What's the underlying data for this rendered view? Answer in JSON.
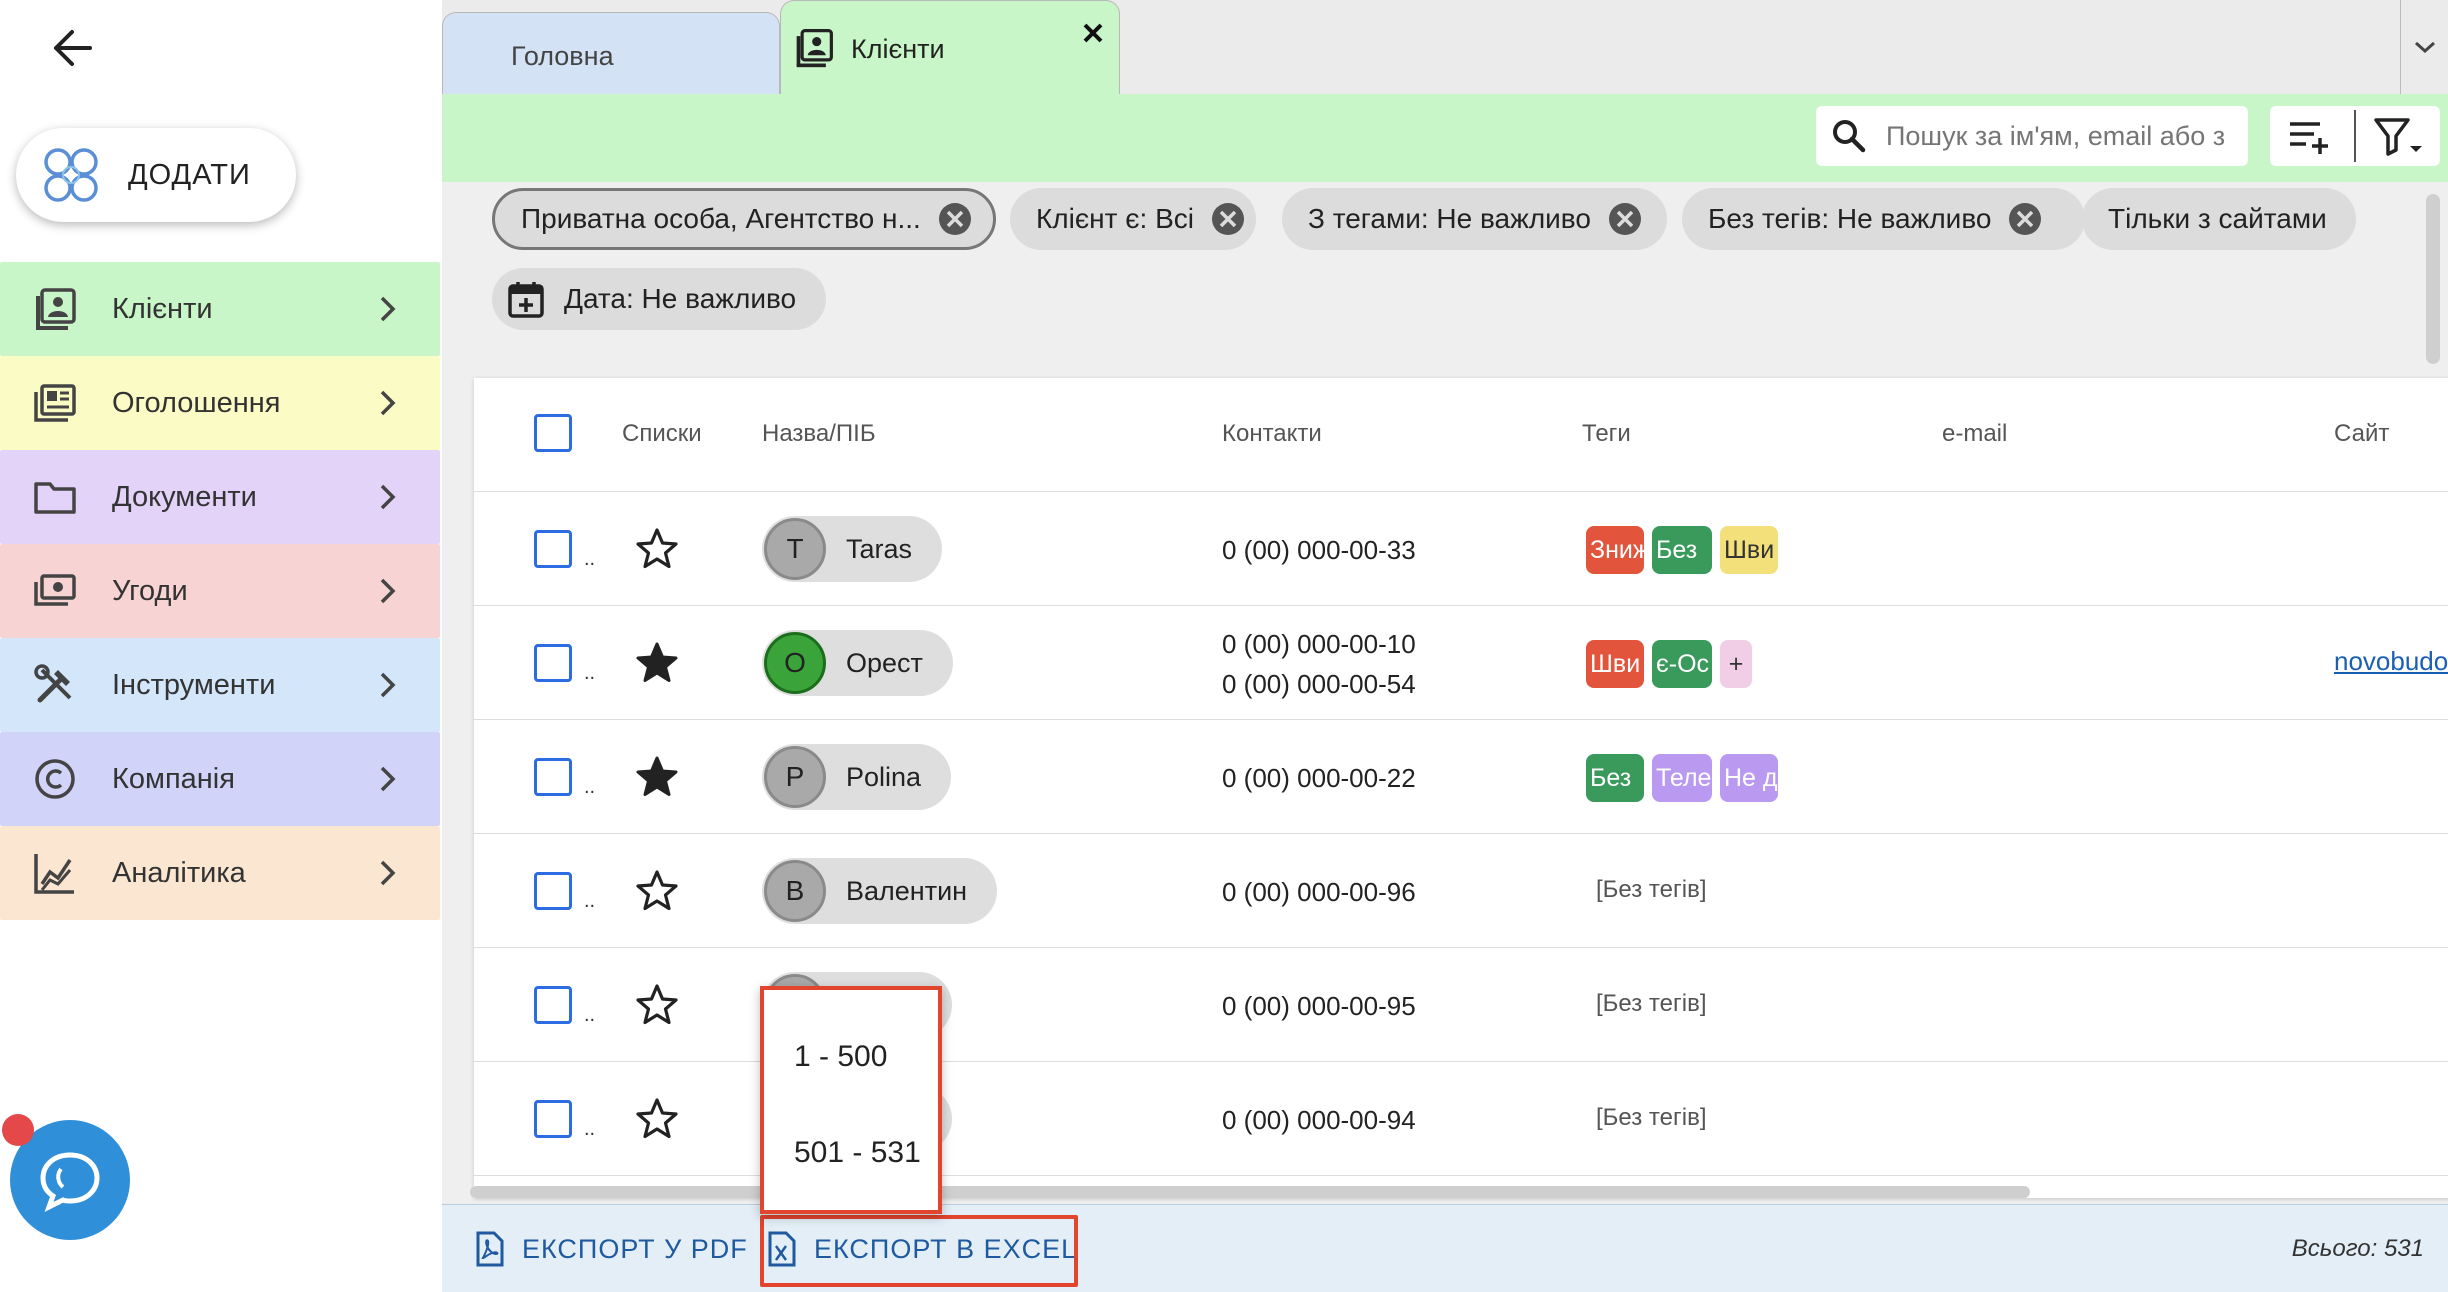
{
  "sidebar": {
    "add_label": "ДОДАТИ",
    "items": [
      {
        "label": "Клієнти",
        "color": "#c9f6c8"
      },
      {
        "label": "Оголошення",
        "color": "#fbfbc6"
      },
      {
        "label": "Документи",
        "color": "#e4d3f8"
      },
      {
        "label": "Угоди",
        "color": "#f7d4d3"
      },
      {
        "label": "Інструменти",
        "color": "#d3e6fa"
      },
      {
        "label": "Компанія",
        "color": "#d2d3f8"
      },
      {
        "label": "Аналітика",
        "color": "#fbe6d2"
      }
    ]
  },
  "tabs": {
    "home": "Головна",
    "clients": "Клієнти"
  },
  "search": {
    "placeholder": "Пошук за ім'ям, email або з"
  },
  "filters": {
    "chip1": "Приватна особа, Агентство н...",
    "chip2": "Клієнт є: Всі",
    "chip3": "З тегами: Не важливо",
    "chip4": "Без тегів: Не важливо",
    "chip5": "Тільки з сайтами",
    "chip6": "Дата: Не важливо"
  },
  "table": {
    "headers": {
      "lists": "Списки",
      "name": "Назва/ПІБ",
      "contacts": "Контакти",
      "tags": "Теги",
      "email": "e-mail",
      "site": "Сайт"
    },
    "rows": [
      {
        "dots": "..",
        "starred": false,
        "initial": "T",
        "name": "Taras",
        "contacts": [
          "0 (00) 000-00-33"
        ],
        "tags": [
          {
            "text": "Зниж",
            "color": "#e2553c"
          },
          {
            "text": "Без",
            "color": "#3a9a5c"
          },
          {
            "text": "Шви",
            "color": "#f3e07a"
          }
        ],
        "site": ""
      },
      {
        "dots": "..",
        "starred": true,
        "initial": "O",
        "name": "Орест",
        "contacts": [
          "0 (00) 000-00-10",
          "0 (00) 000-00-54"
        ],
        "tags": [
          {
            "text": "Шви",
            "color": "#e2553c"
          },
          {
            "text": "є-Ос",
            "color": "#3a9a5c"
          },
          {
            "text": "+",
            "color": "#f1cde6"
          }
        ],
        "site": "novobudov"
      },
      {
        "dots": "..",
        "starred": true,
        "initial": "P",
        "name": "Polina",
        "contacts": [
          "0 (00) 000-00-22"
        ],
        "tags": [
          {
            "text": "Без",
            "color": "#3a9a5c"
          },
          {
            "text": "Теле",
            "color": "#b99af0"
          },
          {
            "text": "Не д",
            "color": "#b99af0"
          }
        ],
        "site": ""
      },
      {
        "dots": "..",
        "starred": false,
        "initial": "В",
        "name": "Валентин",
        "contacts": [
          "0 (00) 000-00-96"
        ],
        "notags": "[Без тегів]",
        "site": ""
      },
      {
        "dots": "..",
        "starred": false,
        "initial": "",
        "name": "",
        "contacts": [
          "0 (00) 000-00-95"
        ],
        "notags": "[Без тегів]",
        "site": ""
      },
      {
        "dots": "..",
        "starred": false,
        "initial": "",
        "name": "",
        "contacts": [
          "0 (00) 000-00-94"
        ],
        "notags": "[Без тегів]",
        "site": ""
      }
    ]
  },
  "export_menu": {
    "items": [
      "1 - 500",
      "501 - 531"
    ]
  },
  "footer": {
    "pdf": "ЕКСПОРТ У PDF",
    "excel": "ЕКСПОРТ В EXCEL",
    "total": "Всього: 531"
  },
  "colors": {
    "accent_blue": "#2b6de0",
    "highlight_red": "#e2442e",
    "clients_green": "#c9f6c8"
  }
}
